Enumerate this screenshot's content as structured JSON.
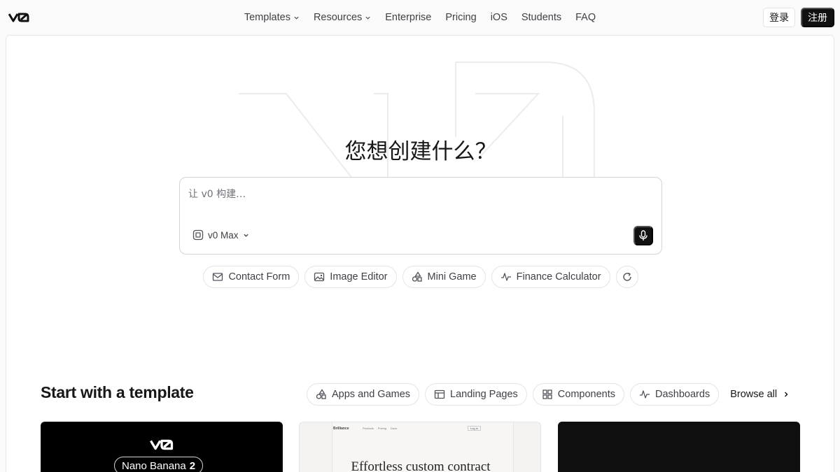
{
  "nav": {
    "logo": "v0",
    "links": [
      {
        "label": "Templates",
        "dropdown": true
      },
      {
        "label": "Resources",
        "dropdown": true
      },
      {
        "label": "Enterprise",
        "dropdown": false
      },
      {
        "label": "Pricing",
        "dropdown": false
      },
      {
        "label": "iOS",
        "dropdown": false
      },
      {
        "label": "Students",
        "dropdown": false
      },
      {
        "label": "FAQ",
        "dropdown": false
      }
    ],
    "login_label": "登录",
    "signup_label": "注册"
  },
  "hero": {
    "title": "您想创建什么？",
    "prompt_placeholder": "让 v0 构建…",
    "model_label": "v0 Max",
    "mic_icon": "microphone-icon"
  },
  "suggestions": [
    {
      "label": "Contact Form",
      "icon": "mail-icon"
    },
    {
      "label": "Image Editor",
      "icon": "image-icon"
    },
    {
      "label": "Mini Game",
      "icon": "shapes-icon"
    },
    {
      "label": "Finance Calculator",
      "icon": "activity-icon"
    }
  ],
  "templates": {
    "title": "Start with a template",
    "filters": [
      {
        "label": "Apps and Games",
        "icon": "shapes-icon"
      },
      {
        "label": "Landing Pages",
        "icon": "layout-icon"
      },
      {
        "label": "Components",
        "icon": "grid-icon"
      },
      {
        "label": "Dashboards",
        "icon": "activity-icon"
      }
    ],
    "browse_all": "Browse all",
    "cards": [
      {
        "logo": "v0",
        "pill_text": "Nano Banana",
        "pill_number": "2"
      },
      {
        "brand": "Brilliance",
        "nav": [
          "Products",
          "Pricing",
          "Docs"
        ],
        "login": "Log in",
        "headline": "Effortless custom contract"
      },
      {}
    ]
  },
  "colors": {
    "accent": "#111111",
    "border": "#e4e4e7",
    "background": "#fafafa"
  }
}
